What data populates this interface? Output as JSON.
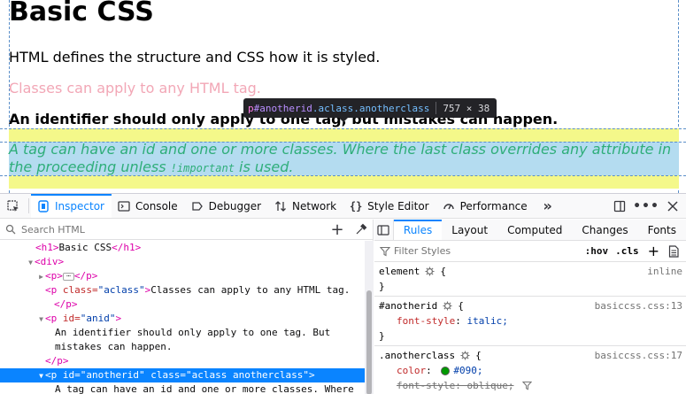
{
  "preview": {
    "heading": "Basic CSS",
    "p1": "HTML defines the structure and CSS how it is styled.",
    "p2": "Classes can apply to any HTML tag.",
    "p3": "An identifier should only apply to one tag, but mistakes can happen.",
    "p4_line1": "A tag can have an id and one or more classes. Where the last class overrides any attribute in",
    "p4_line2_pre": "the proceeding unless",
    "p4_code": "!important",
    "p4_line2_post": "is used.",
    "tooltip": {
      "tag": "p",
      "id": "#anotherid",
      "classes": ".aclass.anotherclass",
      "size": "757 × 38"
    }
  },
  "toolbar": {
    "tabs": [
      {
        "label": "Inspector",
        "icon": "inspector-icon",
        "active": true
      },
      {
        "label": "Console",
        "icon": "console-icon"
      },
      {
        "label": "Debugger",
        "icon": "debugger-icon"
      },
      {
        "label": "Network",
        "icon": "network-icon"
      },
      {
        "label": "Style Editor",
        "icon": "style-editor-icon"
      },
      {
        "label": "Performance",
        "icon": "performance-icon"
      }
    ],
    "more": "»"
  },
  "markup": {
    "search_placeholder": "Search HTML",
    "lines": [
      {
        "t1": "<h1>",
        "text": "Basic CSS",
        "t2": "</h1>"
      },
      {
        "t1": "<div>"
      },
      {
        "t1": "<p>",
        "t2": "</p>"
      },
      {
        "t1": "<p ",
        "attr": "class=",
        "val": "\"aclass\"",
        "t2": ">",
        "text": "Classes can apply to any HTML tag."
      },
      {
        "t1": "</p>"
      },
      {
        "t1": "<p ",
        "attr": "id=",
        "val": "\"anid\"",
        "t2": ">"
      },
      {
        "text": "An identifier should only apply to one tag. But"
      },
      {
        "text": "mistakes can happen."
      },
      {
        "t1": "</p>"
      },
      {
        "t1": "<p ",
        "attr": "id=",
        "val": "\"anotherid\"",
        "attr2": " class=",
        "val2": "\"aclass anotherclass\"",
        "t2": ">"
      },
      {
        "text": "A tag can have an id and one or more classes. Where"
      }
    ]
  },
  "sidebar": {
    "tabs": [
      "Rules",
      "Layout",
      "Computed",
      "Changes",
      "Fonts"
    ],
    "filter_placeholder": "Filter Styles",
    "hov": ":hov",
    "cls": ".cls",
    "rules": [
      {
        "selector": "element",
        "brace": "{",
        "source": "inline",
        "close": "}"
      },
      {
        "selector": "#anotherid",
        "brace": "{",
        "source": "basiccss.css:13",
        "prop": "font-style",
        "value": "italic;",
        "close": "}"
      },
      {
        "selector": ".anotherclass",
        "brace": "{",
        "source": "basiccss.css:17",
        "prop": "color",
        "value": "#090;",
        "prop2": "font-style",
        "value2": "oblique;",
        "close": "}"
      }
    ]
  },
  "colors": {
    "accent": "#0a84ff",
    "swatch": "#009900",
    "highlight_margin": "#f4f88a",
    "highlight_content": "#b4dcf0"
  }
}
